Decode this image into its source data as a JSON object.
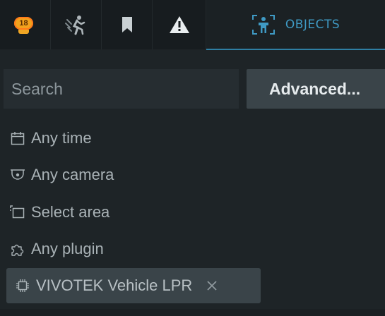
{
  "tabs": {
    "notifications": {
      "icon": "notification-bell-icon",
      "badge_count": "18",
      "badge_color": "#f2a21d"
    },
    "motion": {
      "icon": "motion-person-icon"
    },
    "bookmarks": {
      "icon": "bookmark-icon"
    },
    "events": {
      "icon": "warning-icon"
    },
    "objects": {
      "icon": "object-detection-icon",
      "label": "OBJECTS",
      "active": true,
      "accent_color": "#3f9ac4"
    }
  },
  "search": {
    "placeholder": "Search",
    "value": ""
  },
  "advanced_button": {
    "label": "Advanced..."
  },
  "filters": [
    {
      "icon": "calendar-icon",
      "label": "Any time"
    },
    {
      "icon": "dome-camera-icon",
      "label": "Any camera"
    },
    {
      "icon": "area-select-icon",
      "label": "Select area"
    },
    {
      "icon": "puzzle-icon",
      "label": "Any plugin"
    }
  ],
  "selected_plugin": {
    "icon": "chip-icon",
    "label": "VIVOTEK Vehicle LPR",
    "remove_icon": "close-icon"
  }
}
